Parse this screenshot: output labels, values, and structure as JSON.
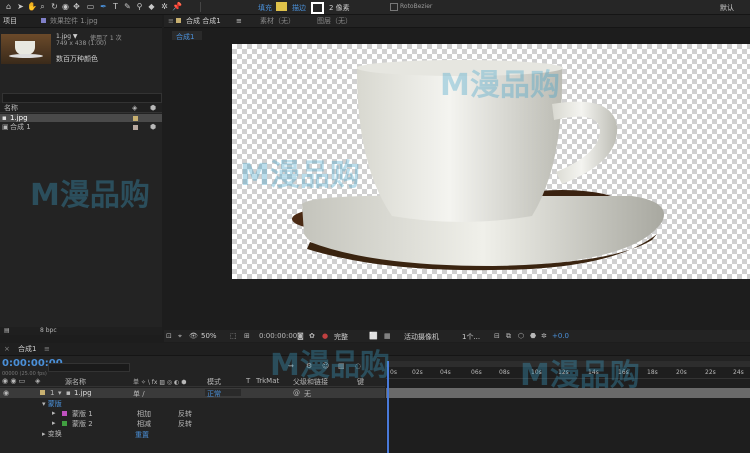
{
  "toolbar": {
    "fill_label": "填充",
    "stroke_label": "描边",
    "stroke_width": "2 像素",
    "rotobezier_label": "RotoBezier",
    "default_label": "默认"
  },
  "project_panel": {
    "tab_project": "项目",
    "tab_effects": "效果控件 1.jpg",
    "file_name": "1.jpg ▼",
    "usage": "使用了 1 次",
    "dims": "749 x 438 (1.00)",
    "colors": "数百万种颜色",
    "col_name": "名称",
    "items": [
      {
        "name": "1.jpg"
      },
      {
        "name": "合成 1"
      }
    ],
    "bpc": "8 bpc"
  },
  "comp_panel": {
    "tab_comp": "合成 合成1",
    "tab_footage": "素材（无）",
    "tab_layer": "图层（无）",
    "breadcrumb": "合成1",
    "zoom": "50%",
    "timecode": "0:00:00:00",
    "quality": "完整",
    "camera": "活动摄像机",
    "views": "1个...",
    "exposure": "+0.0"
  },
  "timeline": {
    "tab": "合成1",
    "timecode": "0:00:00:00",
    "fps": "00000 (25.00 fps)",
    "col_source": "源名称",
    "col_mode": "模式",
    "col_t": "T",
    "col_trkmat": "TrkMat",
    "col_parent": "父级和链接",
    "col_key": "键",
    "layers": [
      {
        "num": "1",
        "name": "1.jpg",
        "mode": "正常",
        "parent": "无"
      }
    ],
    "masks_group": "蒙版",
    "masks": [
      {
        "name": "蒙版 1",
        "mode": "相加",
        "invert": "反转"
      },
      {
        "name": "蒙版 2",
        "mode": "相减",
        "invert": "反转"
      }
    ],
    "transform": "变换",
    "reset": "重置",
    "ruler": [
      "0s",
      "02s",
      "04s",
      "06s",
      "08s",
      "10s",
      "12s",
      "14s",
      "16s",
      "18s",
      "20s",
      "22s",
      "24s"
    ]
  },
  "watermark": "M漫品购"
}
